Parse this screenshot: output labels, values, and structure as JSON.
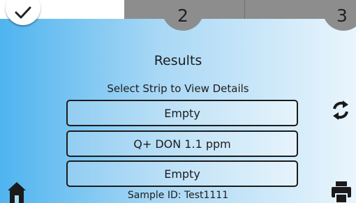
{
  "tabs": [
    {
      "label": "",
      "icon": "check-icon",
      "state": "completed"
    },
    {
      "label": "2",
      "state": "pending"
    },
    {
      "label": "3",
      "state": "pending"
    }
  ],
  "results": {
    "title": "Results",
    "subtitle": "Select Strip to View Details",
    "strips": [
      "Empty",
      "Q+ DON 1.1 ppm",
      "Empty"
    ],
    "sample_id": "Sample ID: Test1111"
  },
  "icons": {
    "refresh": "refresh-icon",
    "home": "home-icon",
    "print": "print-icon"
  },
  "colors": {
    "background_start": "#4fb4ef",
    "background_end": "#e9f5fc",
    "tab_inactive": "#8d8d8d",
    "tab_active": "#ffffff",
    "strip_border": "#1c1c1c"
  }
}
